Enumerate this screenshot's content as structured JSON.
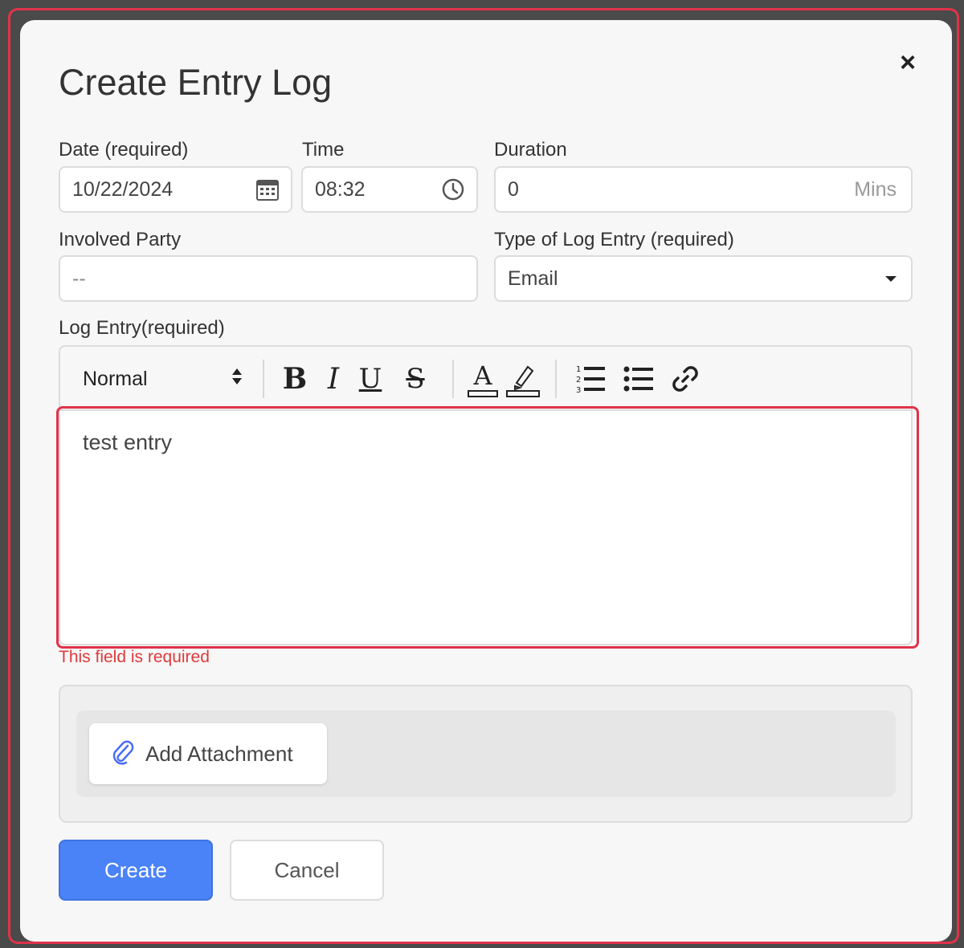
{
  "modal": {
    "title": "Create Entry Log",
    "close_label": "×"
  },
  "fields": {
    "date": {
      "label": "Date (required)",
      "value": "10/22/2024"
    },
    "time": {
      "label": "Time",
      "value": "08:32"
    },
    "duration": {
      "label": "Duration",
      "value": "0",
      "suffix": "Mins"
    },
    "involved_party": {
      "label": "Involved Party",
      "value": "--"
    },
    "log_type": {
      "label": "Type of Log Entry (required)",
      "value": "Email"
    }
  },
  "editor": {
    "label": "Log Entry(required)",
    "format_select": "Normal",
    "toolbar_icons": [
      "bold-icon",
      "italic-icon",
      "underline-icon",
      "strikethrough-icon",
      "text-color-icon",
      "highlight-icon",
      "ordered-list-icon",
      "bullet-list-icon",
      "link-icon"
    ],
    "content": "test entry",
    "error": "This field is required"
  },
  "attachment": {
    "button_label": "Add Attachment"
  },
  "actions": {
    "create_label": "Create",
    "cancel_label": "Cancel"
  },
  "colors": {
    "primary": "#4a82f7",
    "error": "#e03a3a",
    "highlight": "#e0334a"
  }
}
